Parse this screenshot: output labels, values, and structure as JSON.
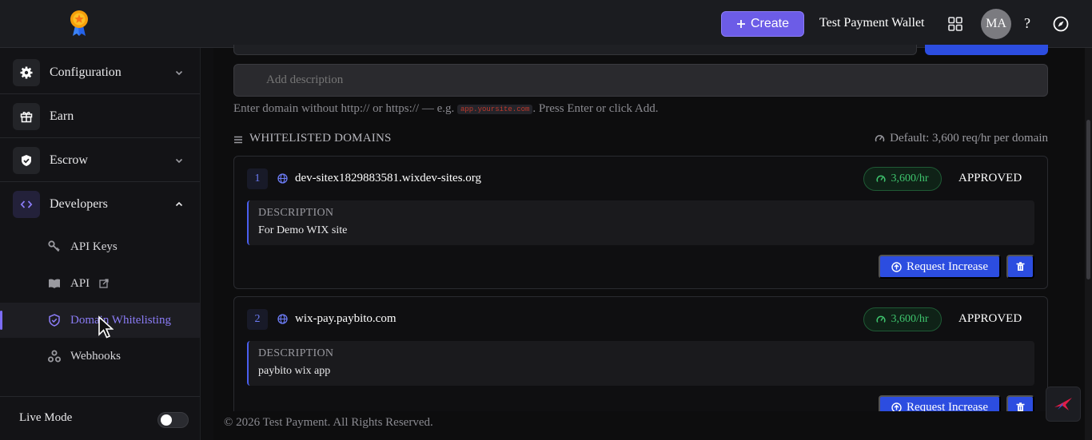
{
  "header": {
    "create_label": "Create",
    "wallet_name": "Test Payment Wallet",
    "avatar_initials": "MA",
    "help_label": "?"
  },
  "sidebar": {
    "items": [
      {
        "label": "Configuration",
        "icon": "gear-icon",
        "expanded": false
      },
      {
        "label": "Earn",
        "icon": "gift-icon"
      },
      {
        "label": "Escrow",
        "icon": "shield-check-icon",
        "expanded": false
      },
      {
        "label": "Developers",
        "icon": "code-icon",
        "expanded": true
      }
    ],
    "sub_items": [
      {
        "label": "API Keys",
        "icon": "key-icon"
      },
      {
        "label": "API",
        "icon": "book-icon",
        "external": true
      },
      {
        "label": "Domain Whitelisting",
        "icon": "shield-icon",
        "active": true
      },
      {
        "label": "Webhooks",
        "icon": "webhook-icon"
      }
    ],
    "live_mode_label": "Live Mode",
    "live_mode_on": false
  },
  "form": {
    "description_placeholder": "Add description",
    "hint_before": "Enter domain without http:// or https:// — e.g.",
    "hint_example": "app.yoursite.com",
    "hint_after": ". Press Enter or click Add."
  },
  "whitelist": {
    "section_title": "WHITELISTED DOMAINS",
    "default_note": "Default: 3,600 req/hr per domain",
    "description_label": "DESCRIPTION",
    "request_label": "Request Increase",
    "domains": [
      {
        "index": "1",
        "domain": "dev-sitex1829883581.wixdev-sites.org",
        "rate": "3,600/hr",
        "status": "APPROVED",
        "description": "For Demo WIX site"
      },
      {
        "index": "2",
        "domain": "wix-pay.paybito.com",
        "rate": "3,600/hr",
        "status": "APPROVED",
        "description": "paybito wix app"
      }
    ]
  },
  "footer": {
    "text": "© 2026 Test Payment. All Rights Reserved."
  },
  "colors": {
    "accent": "#6c5ce7",
    "primary_button": "#2c4de0",
    "success": "#3ec46d"
  }
}
